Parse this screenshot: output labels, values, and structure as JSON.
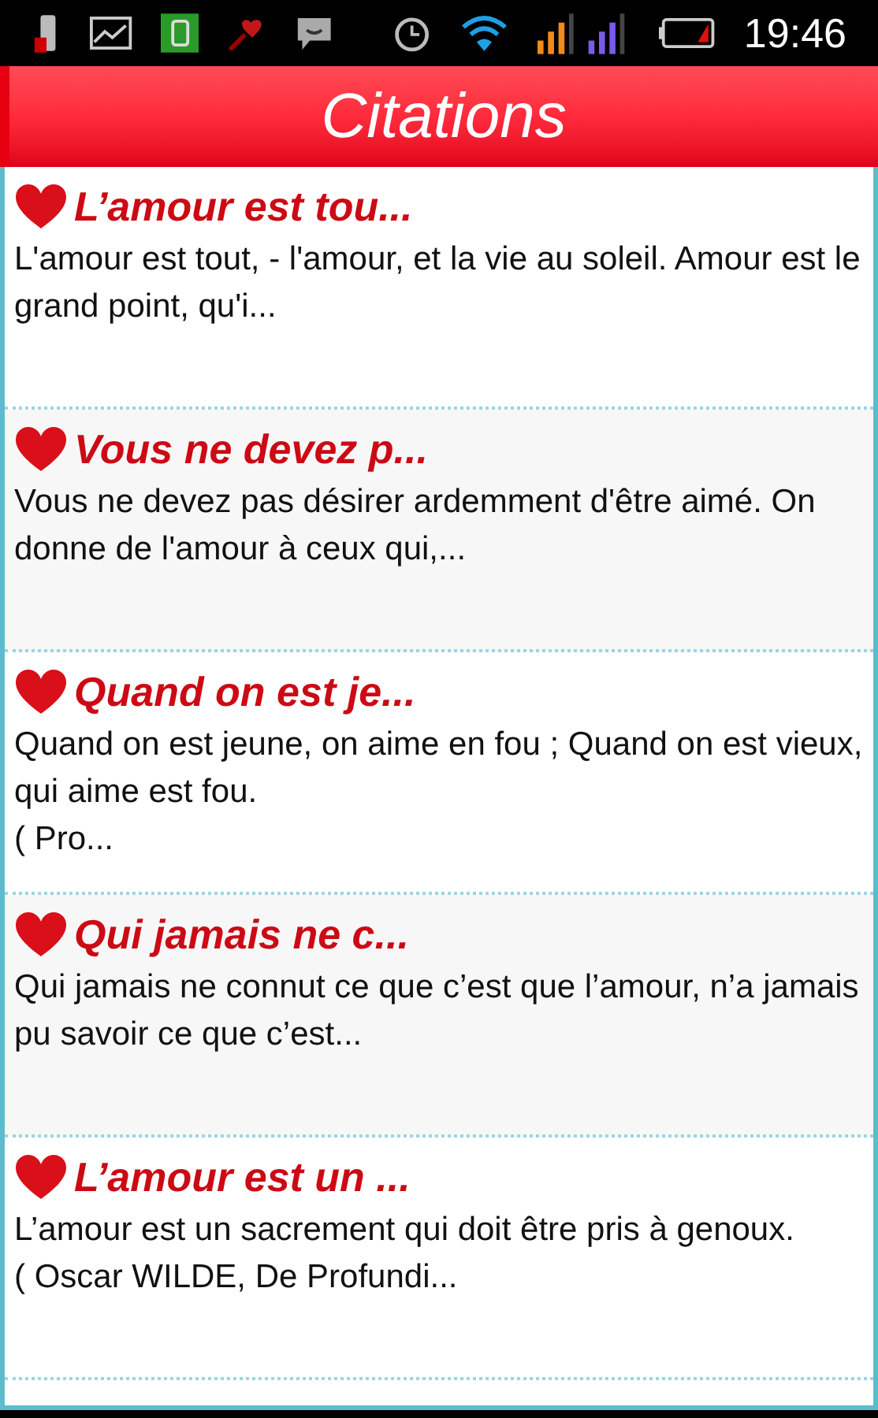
{
  "status_bar": {
    "time": "19:46"
  },
  "header": {
    "title": "Citations"
  },
  "quotes": [
    {
      "title": "L’amour est tou...",
      "text": "L'amour est tout, - l'amour, et la vie au soleil. Amour est le grand point, qu'i..."
    },
    {
      "title": "Vous ne devez p...",
      "text": "Vous ne devez pas désirer ardemment d'être aimé. On donne de l'amour à ceux qui,..."
    },
    {
      "title": "Quand on est je...",
      "text": "Quand on est jeune, on aime en fou ; Quand on est vieux, qui aime est fou.\n( Pro..."
    },
    {
      "title": "Qui jamais ne c...",
      "text": "Qui jamais ne connut ce que c’est que l’amour, n’a jamais pu savoir ce que c’est..."
    },
    {
      "title": "L’amour est un ...",
      "text": "L’amour est un sacrement qui doit être pris à genoux.\n( Oscar WILDE, De Profundi..."
    }
  ]
}
